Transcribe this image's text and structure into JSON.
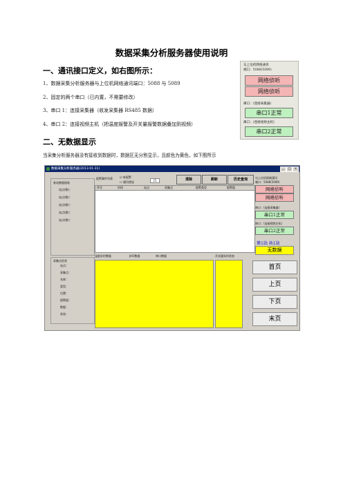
{
  "doc": {
    "title": "数据采集分析服务器使用说明",
    "section1": "一、通讯接口定义，如右图所示：",
    "items": [
      "1、数据采集分析服务器与上位机网络通讯端口：5088 与 5089",
      "2、固定的两个串口（已内置，不需要修改）",
      "3、串口 1：连接采集器（收发采集器 RS485 数据）",
      "4、串口 2：连接视频主机（把温度报警及开关量报警数据叠加到视频）"
    ],
    "section2": "二、无数据显示",
    "para": "当采集分析服务器没有接收到数据时，数据区无分割显示，且颜色为黄色，如下图所示"
  },
  "panel1": {
    "label1": "与上位机网络通讯",
    "label1b": "端口：",
    "port": "5088(5089)",
    "net1": "网络侦听",
    "net2": "网络侦听",
    "serial_label1": "串口：(连接采集器)",
    "serial1": "串口1正常",
    "serial_label2": "串口：(连接视频主机)",
    "serial2": "串口2正常"
  },
  "window": {
    "title": "数据采集分析服务器(2013-01-31)",
    "alarm_list": "报警事件列表",
    "check1": "有报警",
    "check2": "通讯错误",
    "check_num": "15",
    "clear": "清除",
    "refresh": "刷新",
    "history": "历史查询",
    "table_cols": [
      "序号",
      "时间",
      "站点",
      "采集点",
      "报警类型",
      "报警值"
    ],
    "left_group": "各站数据接收",
    "left_items": [
      "站点(数)：",
      "站点(数)：",
      "站点(数)：",
      "站点(数)：",
      "站点(数)："
    ],
    "bottom_group": "采集点信息",
    "bottom_items": [
      "站点：",
      "采集点：",
      "名称：",
      "类型：",
      "位置：",
      "报警值：",
      "数据：",
      "状态："
    ],
    "data_tabs": [
      "温度实时数据",
      "JHO数据",
      "串口数据"
    ],
    "switch_tab": "开关量实时状态",
    "rp_label1": "与上位机网络通讯",
    "rp_port": "端口：5088(5089)",
    "rp_net1": "网络侦听",
    "rp_net2": "网络侦听",
    "rp_serial_label1": "串口：(连接采集器)",
    "rp_serial1": "串口1正常",
    "rp_serial_label2": "串口：(连接视频主机)",
    "rp_serial2": "串口2正常",
    "page_info": "第1站 共1站",
    "no_data": "无数据",
    "nav": [
      "首页",
      "上页",
      "下页",
      "末页"
    ]
  }
}
